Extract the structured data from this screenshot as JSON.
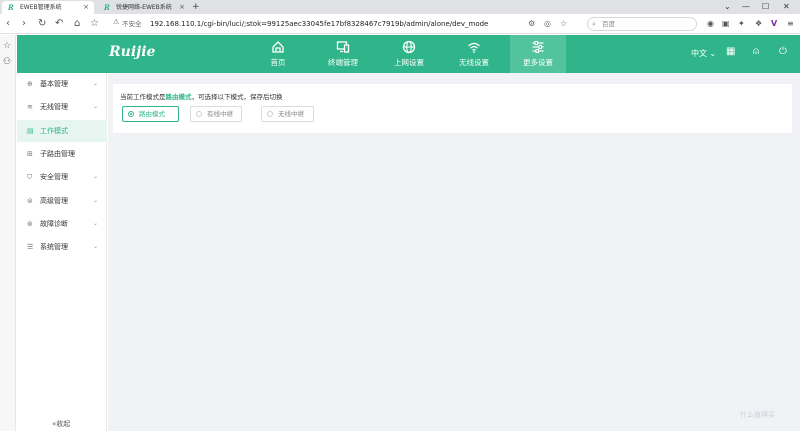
{
  "browser": {
    "tabs": [
      {
        "favicon": "R",
        "title": "EWEB管理系统",
        "close": "×"
      },
      {
        "favicon": "R",
        "title": "锐捷网络-EWEB系统",
        "close": "×"
      }
    ],
    "new_tab": "+",
    "window_controls": [
      "⌄",
      "—",
      "☐",
      "✕"
    ],
    "insecure_label": "不安全",
    "url": "192.168.110.1/cgi-bin/luci/;stok=99125aec33045fe17bf8328467c7919b/admin/alone/dev_mode",
    "search_placeholder": "百度"
  },
  "header": {
    "logo": "Ruijie",
    "nav": [
      {
        "label": "首页",
        "icon": "home-icon"
      },
      {
        "label": "终端管理",
        "icon": "devices-icon"
      },
      {
        "label": "上网设置",
        "icon": "globe-icon"
      },
      {
        "label": "无线设置",
        "icon": "wifi-icon"
      },
      {
        "label": "更多设置",
        "icon": "settings-sliders-icon",
        "active": true
      }
    ],
    "language": "中文",
    "language_caret": "⌄"
  },
  "sidebar": {
    "items": [
      {
        "label": "基本管理",
        "icon": "globe-small-icon",
        "chevron": "⌄"
      },
      {
        "label": "无线管理",
        "icon": "wifi-small-icon",
        "chevron": "⌄"
      },
      {
        "label": "工作模式",
        "icon": "mode-icon",
        "active": true
      },
      {
        "label": "子路由管理",
        "icon": "sub-router-icon"
      },
      {
        "label": "安全管理",
        "icon": "shield-icon",
        "chevron": "⌄"
      },
      {
        "label": "高级管理",
        "icon": "advanced-icon",
        "chevron": "⌄"
      },
      {
        "label": "故障诊断",
        "icon": "diagnose-icon",
        "chevron": "⌄"
      },
      {
        "label": "系统管理",
        "icon": "system-icon",
        "chevron": "⌄"
      }
    ],
    "collapse": "«收起"
  },
  "main": {
    "desc_prefix": "当前工作模式是",
    "desc_mode": "路由模式",
    "desc_suffix": "，可选择以下模式，保存后切换",
    "modes": [
      {
        "label": "路由模式",
        "checked": true
      },
      {
        "label": "有线中继",
        "checked": false
      },
      {
        "label": "无线中继",
        "checked": false
      }
    ]
  },
  "watermark": "什么值得买",
  "colors": {
    "accent": "#2fb589",
    "accent_light": "#52c39c",
    "sidebar_active_bg": "#e6f5ef"
  }
}
